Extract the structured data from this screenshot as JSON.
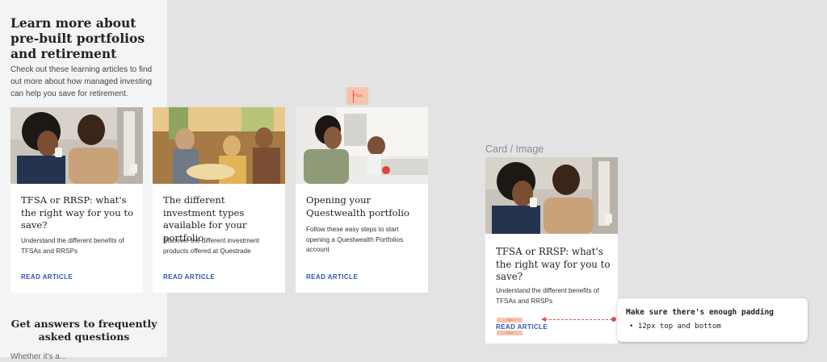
{
  "panel": {
    "heading": "Learn more about pre-built portfolios and retirement",
    "intro": "Check out these learning articles to find out more about how managed investing can help you save for retirement.",
    "faq_heading": "Get answers to frequently asked questions",
    "faq_sub": "Whether it's a..."
  },
  "measure_label": "47px",
  "cards": [
    {
      "title": "TFSA or RRSP: what's the right way for you to save?",
      "description": "Understand the different benefits of TFSAs and RRSPs",
      "link": "READ ARTICLE",
      "image_icon": "couple-coffee-photo"
    },
    {
      "title": "The different investment types available for your portfolio",
      "description": "Discover the different investment products offered at Questrade",
      "link": "READ ARTICLE",
      "image_icon": "family-dinner-photo"
    },
    {
      "title": "Opening your Questwealth portfolio",
      "description": "Follow these easy steps to start opening a Questwealth Portfolios account",
      "link": "READ ARTICLE",
      "image_icon": "mother-child-phone-photo"
    }
  ],
  "detail": {
    "frame_label": "Card / Image",
    "card": {
      "title": "TFSA or RRSP: what's the right way for you to save?",
      "description": "Understand the different benefits of TFSAs and RRSPs",
      "link": "READ ARTICLE"
    },
    "pad_top_tag": "12px",
    "pad_bottom_tag": "12px"
  },
  "note": {
    "title": "Make sure there's enough padding",
    "bullet": "• 12px top and bottom"
  },
  "colors": {
    "canvas": "#e3e3e3",
    "link": "#2a55b4",
    "annotation": "#d9534f",
    "measure_fill": "#f6c4ad"
  }
}
